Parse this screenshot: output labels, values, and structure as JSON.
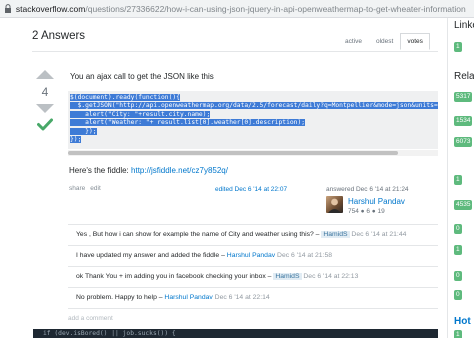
{
  "browser": {
    "url_domain": "stackoverflow.com",
    "url_path": "/questions/27336622/how-i-can-using-json-jquery-in-api-openweathermap-to-get-wheater-information"
  },
  "answers_header": "2 Answers",
  "sort_tabs": [
    {
      "label": "active"
    },
    {
      "label": "oldest"
    },
    {
      "label": "votes"
    }
  ],
  "answer": {
    "vote_count": "4",
    "intro": "You an ajax call to get the JSON like this",
    "code_lines": [
      "$(document).ready(function(){",
      "  $.getJSON(\"http://api.openweathermap.org/data/2.5/forecast/daily?q=Montpellier&mode=json&units=",
      "    alert(\"City: \"+result.city.name);",
      "    alert(\"Weather: \"+ result.list[0].weather[0].description);",
      "    });",
      "});"
    ],
    "fiddle_prefix": "Here's the fiddle: ",
    "fiddle_link": "http://jsfiddle.net/cz7y852q/",
    "share_label": "share",
    "edit_label": "edit",
    "edited_text": "edited Dec 6 '14 at 22:07",
    "answered_text": "answered Dec 6 '14 at 21:24",
    "user_name": "Harshul Pandav",
    "user_rep": "754 ● 6 ● 19"
  },
  "comments": [
    {
      "text": "Yes , But how i can show for example the name of City and weather using this? – ",
      "user": "HamidS",
      "date": " Dec 6 '14 at 21:44",
      "badge": true
    },
    {
      "text": "I have updated my answer and added the fiddle – ",
      "user": "Harshul Pandav",
      "date": " Dec 6 '14 at 21:58",
      "badge": false
    },
    {
      "text": "ok Thank You + im adding you in facebook checking your inbox – ",
      "user": "HamidS",
      "date": " Dec 6 '14 at 22:13",
      "badge": true
    },
    {
      "text": "No problem. Happy to help – ",
      "user": "Harshul Pandav",
      "date": " Dec 6 '14 at 22:14",
      "badge": false
    }
  ],
  "add_comment_label": "add a comment",
  "next_answer_code": "if (dev.isBored() || job.sucks()) {",
  "sidebar": {
    "linked_heading": "Linke",
    "related_heading": "Rela",
    "hot_heading": "Hot",
    "badges": [
      "1",
      "5317",
      "1534",
      "6073",
      "1",
      "4535",
      "0",
      "1",
      "0",
      "0",
      "1",
      "1"
    ]
  }
}
